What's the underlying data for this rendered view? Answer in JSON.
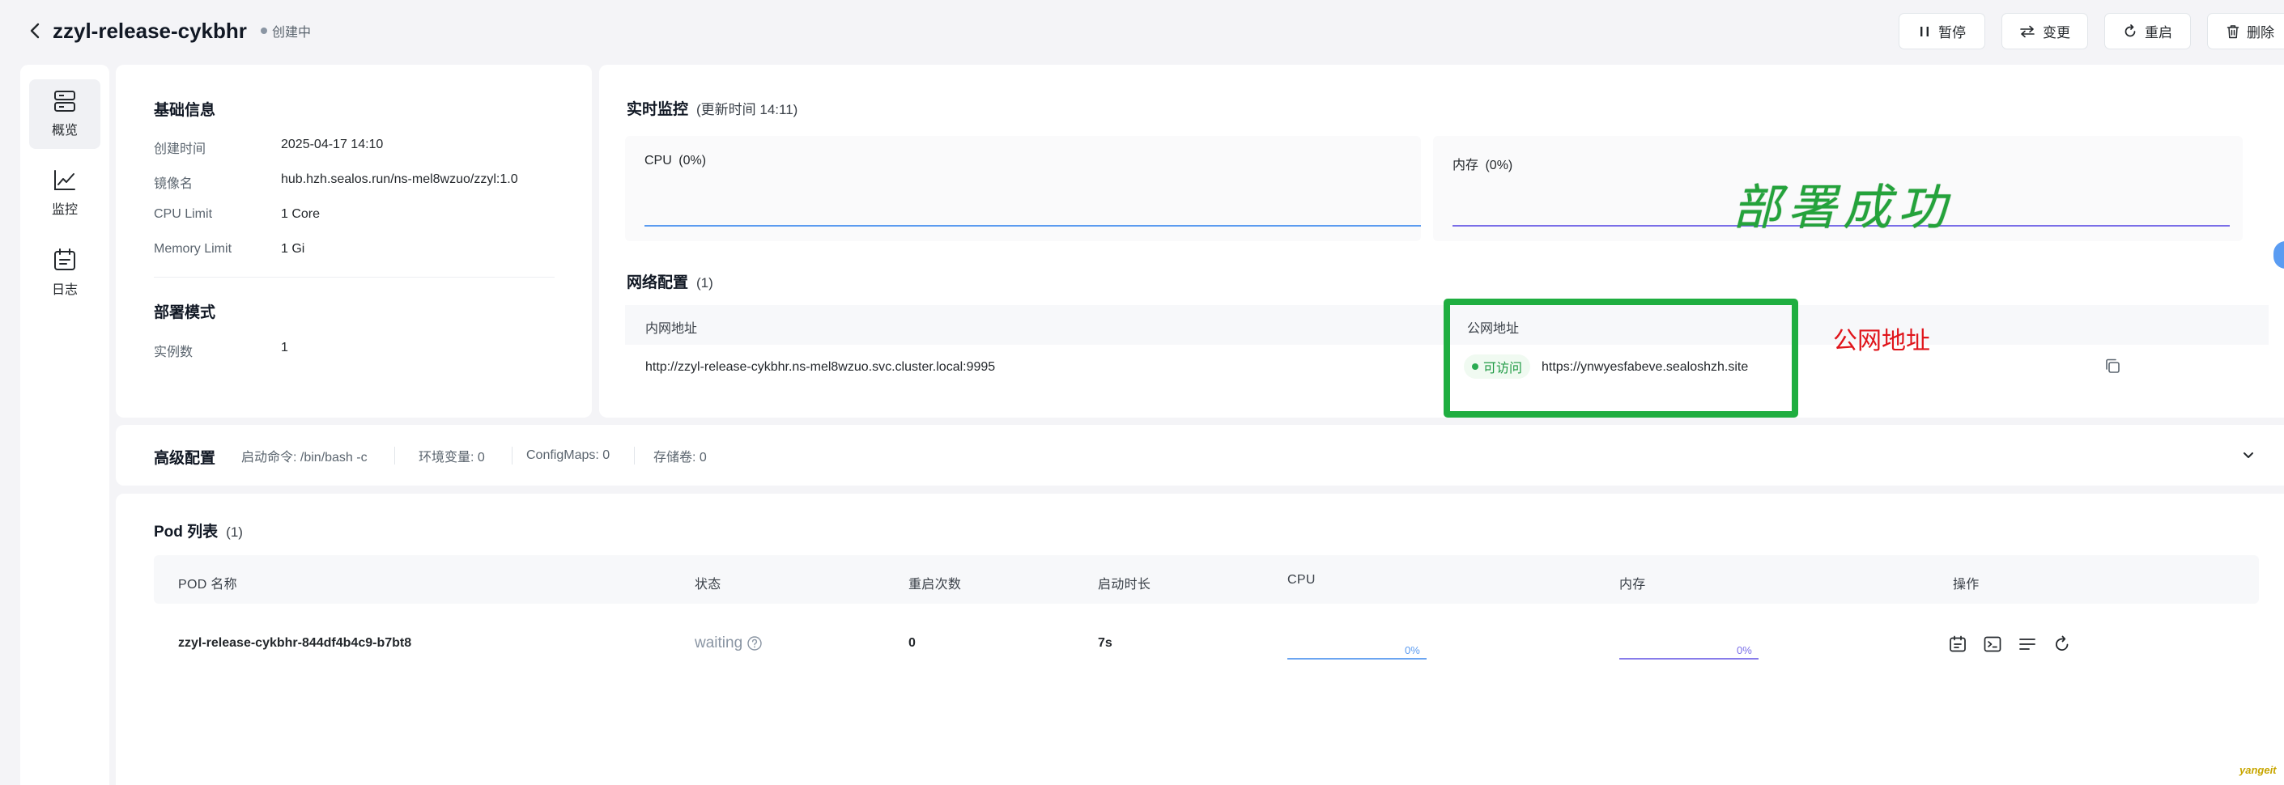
{
  "header": {
    "title": "zzyl-release-cykbhr",
    "status": "创建中",
    "buttons": {
      "pause": "暂停",
      "change": "变更",
      "restart": "重启",
      "delete": "删除"
    }
  },
  "sidenav": {
    "items": [
      {
        "label": "概览",
        "icon": "server-icon",
        "active": true
      },
      {
        "label": "监控",
        "icon": "line-chart-icon",
        "active": false
      },
      {
        "label": "日志",
        "icon": "calendar-log-icon",
        "active": false
      }
    ]
  },
  "basic_info": {
    "title": "基础信息",
    "rows": [
      {
        "label": "创建时间",
        "value": "2025-04-17 14:10"
      },
      {
        "label": "镜像名",
        "value": "hub.hzh.sealos.run/ns-mel8wzuo/zzyl:1.0"
      },
      {
        "label": "CPU Limit",
        "value": "1 Core"
      },
      {
        "label": "Memory Limit",
        "value": "1 Gi"
      }
    ]
  },
  "deploy_mode": {
    "title": "部署模式",
    "rows": [
      {
        "label": "实例数",
        "value": "1"
      }
    ]
  },
  "monitor": {
    "title": "实时监控",
    "updated": "(更新时间  14:11)",
    "cpu_label": "CPU",
    "cpu_value": "(0%)",
    "memory_label": "内存",
    "memory_value": "(0%)",
    "cpu_color": "#5b9bf0",
    "memory_color": "#7a6ee8"
  },
  "network": {
    "title": "网络配置",
    "count": "(1)",
    "private_header": "内网地址",
    "public_header": "公网地址",
    "private_address": "http://zzyl-release-cykbhr.ns-mel8wzuo.svc.cluster.local:9995",
    "access_status": "可访问",
    "public_address": "https://ynwyesfabeve.sealoshzh.site"
  },
  "advanced": {
    "title": "高级配置",
    "items": [
      "启动命令: /bin/bash -c",
      "环境变量: 0",
      "ConfigMaps: 0",
      "存储卷: 0"
    ]
  },
  "pods": {
    "title": "Pod 列表",
    "count": "(1)",
    "columns": [
      "POD 名称",
      "状态",
      "重启次数",
      "启动时长",
      "CPU",
      "内存",
      "操作"
    ],
    "rows": [
      {
        "name": "zzyl-release-cykbhr-844df4b4c9-b7bt8",
        "status": "waiting",
        "restarts": "0",
        "uptime": "7s",
        "cpu_percent": "0%",
        "cpu_fraction": 0,
        "memory_percent": "0%",
        "memory_fraction": 0
      }
    ],
    "cpu_color": "#5b9bf0",
    "memory_color": "#7a6ee8"
  },
  "annotations": {
    "success": "部署成功",
    "public_label": "公网地址",
    "highlight_color": "#1fae40",
    "label_color": "#e0151b"
  },
  "watermark": "yangeit"
}
